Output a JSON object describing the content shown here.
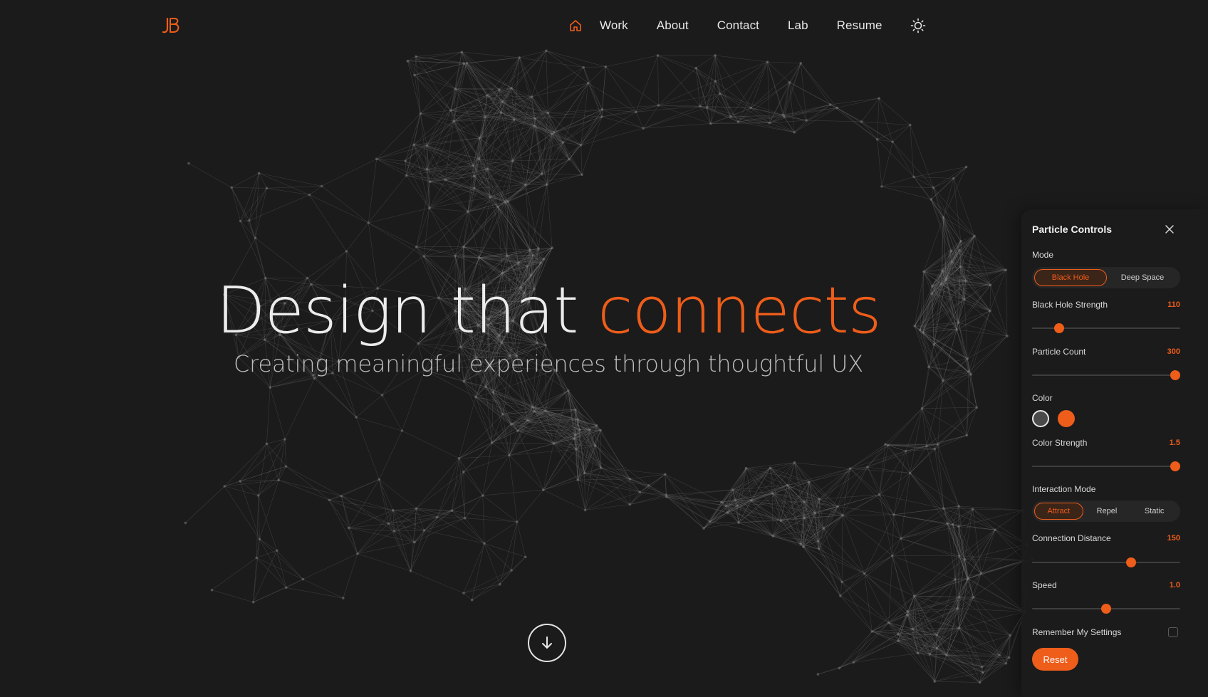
{
  "brand": {
    "logo_text": "JB",
    "accent_color": "#ee5d1a",
    "background_color": "#1b1b1b"
  },
  "nav": {
    "home_icon": "home-icon",
    "links": [
      "Work",
      "About",
      "Contact",
      "Lab",
      "Resume"
    ],
    "theme_icon": "sun-icon"
  },
  "hero": {
    "title_main": "Design that ",
    "title_accent": "connects",
    "subtitle": "Creating meaningful experiences through thoughtful UX",
    "scroll_icon": "arrow-down-icon"
  },
  "panel": {
    "title": "Particle Controls",
    "close_icon": "close-icon",
    "mode": {
      "label": "Mode",
      "options": [
        "Black Hole",
        "Deep Space"
      ],
      "selected": "Black Hole"
    },
    "black_hole_strength": {
      "label": "Black Hole Strength",
      "value": "110",
      "fraction": 0.16
    },
    "particle_count": {
      "label": "Particle Count",
      "value": "300",
      "fraction": 1.0
    },
    "color": {
      "label": "Color",
      "swatches": [
        "#4a4a4a",
        "#ee5d1a"
      ],
      "selected": "#4a4a4a"
    },
    "color_strength": {
      "label": "Color Strength",
      "value": "1.5",
      "fraction": 1.0
    },
    "interaction_mode": {
      "label": "Interaction Mode",
      "options": [
        "Attract",
        "Repel",
        "Static"
      ],
      "selected": "Attract"
    },
    "connection_distance": {
      "label": "Connection Distance",
      "value": "150",
      "fraction": 0.68
    },
    "speed": {
      "label": "Speed",
      "value": "1.0",
      "fraction": 0.5
    },
    "remember": {
      "label": "Remember My Settings",
      "checked": false
    },
    "reset_label": "Reset"
  }
}
